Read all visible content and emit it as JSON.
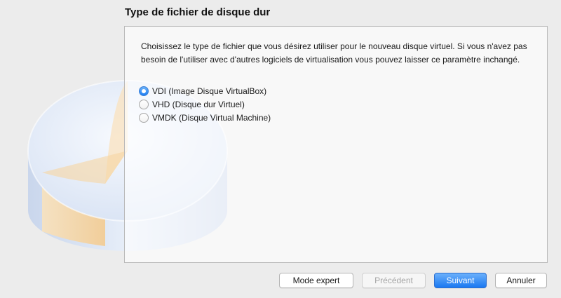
{
  "header": {
    "title": "Type de fichier de disque dur"
  },
  "description": "Choisissez le type de fichier que vous désirez utiliser pour le nouveau disque virtuel. Si vous n'avez pas besoin de l'utiliser avec d'autres logiciels de virtualisation vous pouvez laisser ce paramètre inchangé.",
  "options": [
    {
      "label": "VDI (Image Disque VirtualBox)",
      "selected": true
    },
    {
      "label": "VHD (Disque dur Virtuel)",
      "selected": false
    },
    {
      "label": "VMDK (Disque Virtual Machine)",
      "selected": false
    }
  ],
  "buttons": {
    "expert": "Mode expert",
    "previous": "Précédent",
    "next": "Suivant",
    "cancel": "Annuler"
  },
  "colors": {
    "accent": "#1a78f1",
    "disk_highlight": "#f9d9a6"
  }
}
